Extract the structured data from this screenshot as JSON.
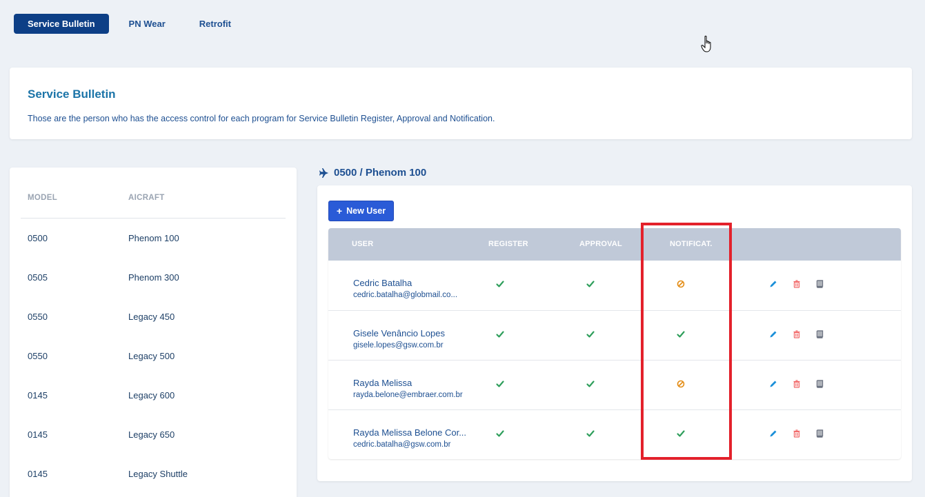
{
  "tabs": [
    {
      "label": "Service Bulletin",
      "active": true
    },
    {
      "label": "PN Wear",
      "active": false
    },
    {
      "label": "Retrofit",
      "active": false
    }
  ],
  "header": {
    "title": "Service Bulletin",
    "description": "Those are the person who has the access control for each program for Service Bulletin Register, Approval and Notification."
  },
  "models": {
    "headers": {
      "model": "MODEL",
      "aircraft": "AICRAFT"
    },
    "rows": [
      {
        "model": "0500",
        "aircraft": "Phenom 100"
      },
      {
        "model": "0505",
        "aircraft": "Phenom 300"
      },
      {
        "model": "0550",
        "aircraft": "Legacy 450"
      },
      {
        "model": "0550",
        "aircraft": "Legacy 500"
      },
      {
        "model": "0145",
        "aircraft": "Legacy 600"
      },
      {
        "model": "0145",
        "aircraft": "Legacy 650"
      },
      {
        "model": "0145",
        "aircraft": "Legacy Shuttle"
      }
    ]
  },
  "section": {
    "title": "0500 / Phenom 100",
    "icon": "plane-icon"
  },
  "new_user_label": "New User",
  "users_table": {
    "headers": {
      "user": "USER",
      "register": "REGISTER",
      "approval": "APPROVAL",
      "notification": "NOTIFICAT."
    },
    "rows": [
      {
        "name": "Cedric Batalha",
        "email": "cedric.batalha@globmail.co...",
        "register": "check",
        "approval": "check",
        "notification": "blocked"
      },
      {
        "name": "Gisele Venâncio Lopes",
        "email": "gisele.lopes@gsw.com.br",
        "register": "check",
        "approval": "check",
        "notification": "check"
      },
      {
        "name": "Rayda Melissa",
        "email": "rayda.belone@embraer.com.br",
        "register": "check",
        "approval": "check",
        "notification": "blocked"
      },
      {
        "name": "Rayda Melissa Belone Cor...",
        "email": "cedric.batalha@gsw.com.br",
        "register": "check",
        "approval": "check",
        "notification": "check"
      }
    ]
  },
  "colors": {
    "primary": "#0d3f86",
    "button": "#2a5bd7",
    "check": "#2e9e5b",
    "blocked": "#e38b12",
    "edit": "#1a8fd8",
    "delete": "#f26b6b",
    "book": "#6b7280",
    "highlight": "#e3212b"
  }
}
